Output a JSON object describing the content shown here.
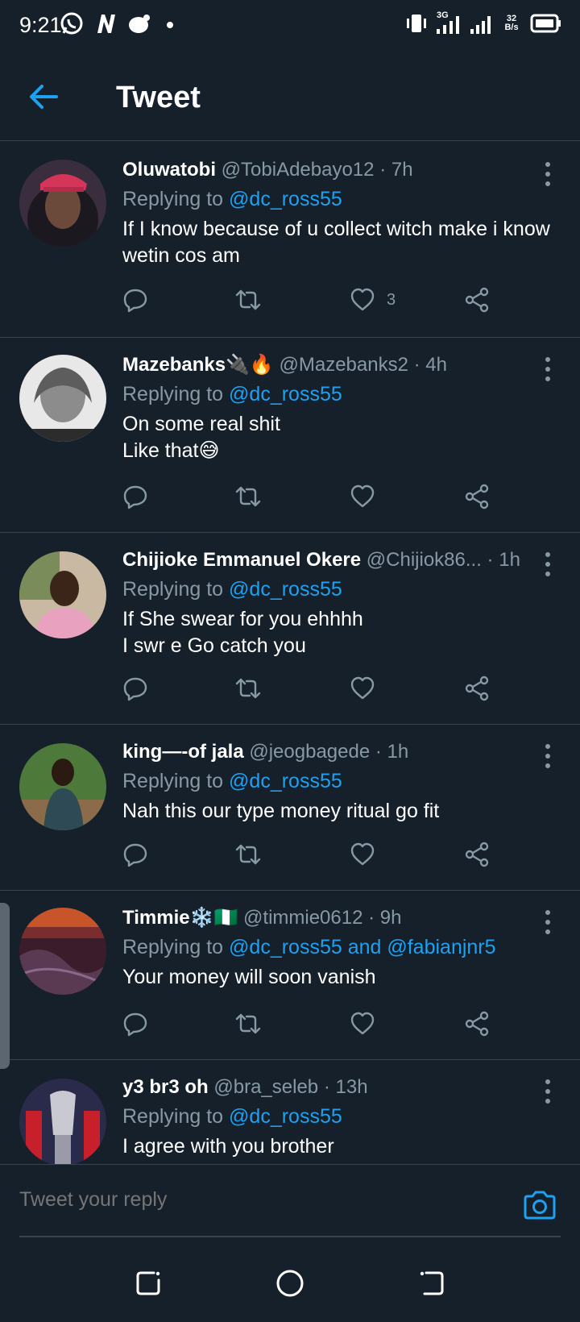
{
  "status_bar": {
    "time": "9:21",
    "network_type": "3G",
    "speed_value": "32",
    "speed_unit": "B/s"
  },
  "header": {
    "title": "Tweet"
  },
  "tweets": [
    {
      "name": "Oluwatobi",
      "handle": "@TobiAdebayo12",
      "time": "7h",
      "replying_prefix": "Replying to",
      "mentions": "@dc_ross55",
      "text_lines": [
        "If I know because of u collect witch make i know",
        "wetin cos am"
      ],
      "like_count": "3"
    },
    {
      "name": "Mazebanks🔌🔥",
      "handle": "@Mazebanks2",
      "time": "4h",
      "replying_prefix": "Replying to",
      "mentions": "@dc_ross55",
      "text_lines": [
        "On some real shit",
        "Like that😅"
      ],
      "like_count": ""
    },
    {
      "name": "Chijioke Emmanuel Okere",
      "handle": "@Chijiok86...",
      "time": "1h",
      "replying_prefix": "Replying to",
      "mentions": "@dc_ross55",
      "text_lines": [
        "If She swear for you ehhhh",
        "I swr e Go catch you"
      ],
      "like_count": ""
    },
    {
      "name": "king—-of jala",
      "handle": "@jeogbagede",
      "time": "1h",
      "replying_prefix": "Replying to",
      "mentions": "@dc_ross55",
      "text_lines": [
        "Nah this our type money ritual go fit"
      ],
      "like_count": ""
    },
    {
      "name": "Timmie❄️🇳🇬",
      "handle": "@timmie0612",
      "time": "9h",
      "replying_prefix": "Replying to",
      "mentions": "@dc_ross55 and @fabianjnr5",
      "text_lines": [
        "Your money will soon vanish"
      ],
      "like_count": ""
    },
    {
      "name": "y3 br3 oh",
      "handle": "@bra_seleb",
      "time": "13h",
      "replying_prefix": "Replying to",
      "mentions": "@dc_ross55",
      "text_lines": [
        "I agree with you brother"
      ],
      "like_count": ""
    }
  ],
  "composer": {
    "placeholder": "Tweet your reply"
  },
  "colors": {
    "background": "#15202b",
    "accent": "#1da1f2",
    "muted": "#8899a6",
    "divider": "#38444d"
  }
}
